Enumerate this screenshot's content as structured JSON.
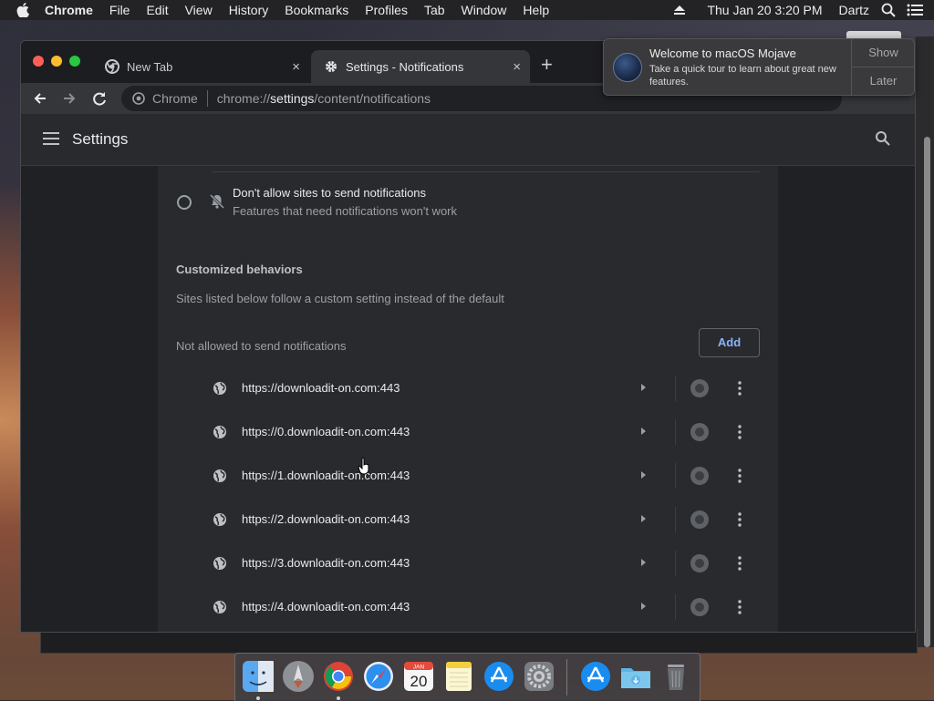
{
  "menubar": {
    "app": "Chrome",
    "items": [
      "File",
      "Edit",
      "View",
      "History",
      "Bookmarks",
      "Profiles",
      "Tab",
      "Window",
      "Help"
    ],
    "datetime": "Thu Jan 20  3:20 PM",
    "user": "Dartz"
  },
  "tabs": [
    {
      "title": "New Tab",
      "close": "×"
    },
    {
      "title": "Settings - Notifications",
      "close": "×"
    }
  ],
  "newtab_label": "+",
  "omnibox": {
    "site_label": "Chrome",
    "url_prefix": "chrome://",
    "url_host": "settings",
    "url_path": "/content/notifications"
  },
  "settings": {
    "title": "Settings",
    "option": {
      "title": "Don't allow sites to send notifications",
      "subtitle": "Features that need notifications won't work"
    },
    "section_title": "Customized behaviors",
    "section_desc": "Sites listed below follow a custom setting instead of the default",
    "not_allowed_label": "Not allowed to send notifications",
    "add_button": "Add",
    "sites": [
      "https://downloadit-on.com:443",
      "https://0.downloadit-on.com:443",
      "https://1.downloadit-on.com:443",
      "https://2.downloadit-on.com:443",
      "https://3.downloadit-on.com:443",
      "https://4.downloadit-on.com:443"
    ]
  },
  "notification": {
    "title": "Welcome to macOS Mojave",
    "body": "Take a quick tour to learn about great new features.",
    "show_button": "Show",
    "later_button": "Later"
  },
  "dock": {
    "calendar_month": "JAN",
    "calendar_day": "20"
  },
  "colors": {
    "accent": "#8ab4f8",
    "close": "#ff5f57",
    "minimize": "#febc2e",
    "maximize": "#28c840"
  }
}
